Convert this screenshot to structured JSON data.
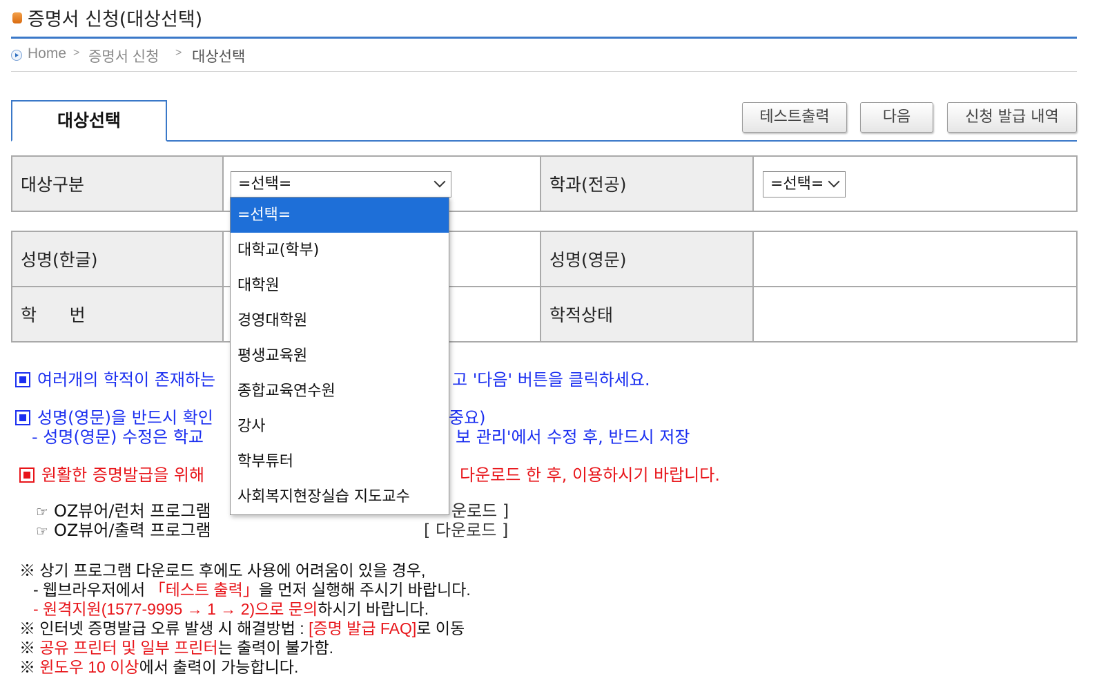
{
  "header": {
    "title": "증명서 신청(대상선택)"
  },
  "breadcrumb": {
    "home": "Home",
    "level1": "증명서 신청",
    "current": "대상선택"
  },
  "tabs": {
    "active": "대상선택"
  },
  "buttons": {
    "test_print": "테스트출력",
    "next": "다음",
    "history": "신청 발급 내역"
  },
  "form": {
    "target_label": "대상구분",
    "target_value": "=선택=",
    "dept_label": "학과(전공)",
    "dept_value": "=선택=",
    "name_kr_label": "성명(한글)",
    "name_en_label": "성명(영문)",
    "student_no_label": "학      번",
    "status_label": "학적상태"
  },
  "dropdown_options": [
    "=선택=",
    "대학교(학부)",
    "대학원",
    "경영대학원",
    "평생교육원",
    "종합교육연수원",
    "강사",
    "학부튜터",
    "사회복지현장실습 지도교수"
  ],
  "messages": {
    "m1_left": "여러개의 학적이 존재하는",
    "m1_right": "고 '다음' 버튼을 클릭하세요.",
    "m2_left": "성명(영문)을 반드시 확인",
    "m2_right": "중요)",
    "m3_left": "- 성명(영문) 수정은 학교",
    "m3_right": "보 관리'에서 수정 후, 반드시 저장",
    "m4_left": "원활한 증명발급을 위해",
    "m4_right": "다운로드 한 후, 이용하시기 바랍니다."
  },
  "programs": {
    "p1": "OZ뷰어/런처 프로그램",
    "p1_dl": "운로드 ]",
    "p2": "OZ뷰어/출력 프로그램",
    "p2_dl": "[ 다운로드 ]",
    "hand": "☞"
  },
  "notes": {
    "n1": "※ 상기 프로그램 다운로드 후에도 사용에 어려움이 있을 경우,",
    "n2_a": "- 웹브라우저에서 ",
    "n2_red": "「테스트 출력」",
    "n2_b": "을 먼저 실행해 주시기 바랍니다.",
    "n3_red": "- 원격지원(1577-9995 → 1 → 2)으로 문의",
    "n3_b": "하시기 바랍니다.",
    "n4_a": "※ 인터넷 증명발급 오류 발생 시 해결방법 : ",
    "n4_red": "[증명 발급 FAQ]",
    "n4_b": "로 이동",
    "n5_a": "※ ",
    "n5_red": "공유 프린터 및 일부 프린터",
    "n5_b": "는 출력이 불가함.",
    "n6_a": "※ ",
    "n6_red": "윈도우 10 이상",
    "n6_b": "에서 출력이 가능합니다."
  },
  "colors": {
    "accent": "#3a78c8",
    "highlight": "#1e6fd8",
    "info_blue": "#1b2ff0",
    "alert_red": "#e8151a"
  }
}
